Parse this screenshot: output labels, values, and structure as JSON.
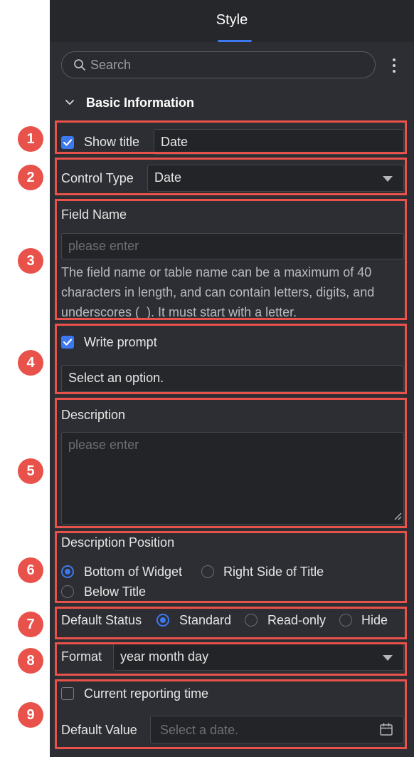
{
  "header": {
    "tab_label": "Style"
  },
  "search": {
    "placeholder": "Search"
  },
  "section": {
    "title": "Basic Information"
  },
  "show_title": {
    "label": "Show title",
    "checked": true,
    "value": "Date"
  },
  "control_type": {
    "label": "Control Type",
    "value": "Date"
  },
  "field_name": {
    "label": "Field Name",
    "placeholder": "please enter",
    "helper_line1": "The field name or table name can be a maximum of 40",
    "helper_line2": "characters in length, and can contain letters, digits, and",
    "helper_line3": "underscores (_). It must start with a letter."
  },
  "write_prompt": {
    "label": "Write prompt",
    "checked": true,
    "select_placeholder": "Select an option."
  },
  "description": {
    "label": "Description",
    "placeholder": "please enter"
  },
  "description_position": {
    "label": "Description Position",
    "options": [
      "Bottom of Widget",
      "Right Side of Title",
      "Below Title"
    ],
    "selected": "Bottom of Widget"
  },
  "default_status": {
    "label": "Default Status",
    "options": [
      "Standard",
      "Read-only",
      "Hide"
    ],
    "selected": "Standard"
  },
  "format": {
    "label": "Format",
    "value": "year month day"
  },
  "current_reporting_time": {
    "label": "Current reporting time",
    "checked": false
  },
  "default_value": {
    "label": "Default Value",
    "placeholder": "Select a date."
  },
  "badges": [
    "1",
    "2",
    "3",
    "4",
    "5",
    "6",
    "7",
    "8",
    "9"
  ],
  "colors": {
    "accent": "#3c78ef",
    "panel": "#2d2e33",
    "highlight": "#e8524a"
  }
}
